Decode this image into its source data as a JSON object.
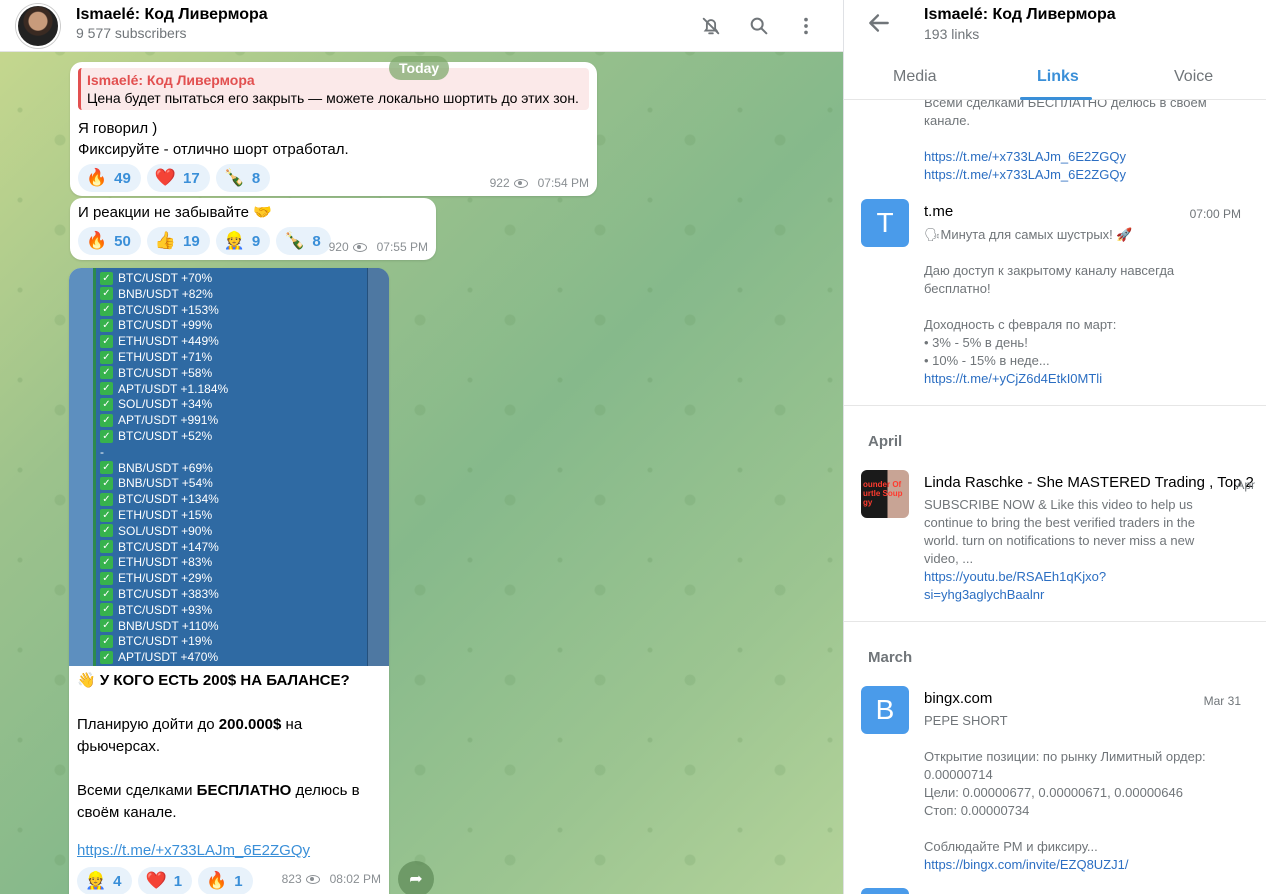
{
  "chat": {
    "title": "Ismaelé: Код Ливермора",
    "subtitle": "9 577 subscribers",
    "date_pill": "Today",
    "messages": [
      {
        "reply_name": "Ismaelé: Код Ливермора",
        "reply_text": "Цена будет пытаться его закрыть — можете локально шортить до этих зон.",
        "text": "Я говорил )\nФиксируйте - отлично шорт отработал.",
        "reactions": [
          {
            "emoji": "🔥",
            "count": "49"
          },
          {
            "emoji": "❤️",
            "count": "17"
          },
          {
            "emoji": "🍾",
            "count": "8"
          }
        ],
        "views": "922",
        "time": "07:54 PM"
      },
      {
        "text": "И реакции не забывайте 🤝",
        "reactions": [
          {
            "emoji": "🔥",
            "count": "50"
          },
          {
            "emoji": "👍",
            "count": "19"
          },
          {
            "emoji": "👷",
            "count": "9"
          },
          {
            "emoji": "🍾",
            "count": "8"
          }
        ],
        "views": "920",
        "time": "07:55 PM"
      },
      {
        "trades": [
          "BTC/USDT +70%",
          "BNB/USDT +82%",
          "BTC/USDT +153%",
          "BTC/USDT +99%",
          "ETH/USDT +449%",
          "ETH/USDT +71%",
          "BTC/USDT +58%",
          "APT/USDT +1.184%",
          "SOL/USDT +34%",
          "APT/USDT +991%",
          "BTC/USDT +52%",
          "-",
          "BNB/USDT +69%",
          "BNB/USDT +54%",
          "BTC/USDT +134%",
          "ETH/USDT +15%",
          "SOL/USDT +90%",
          "BTC/USDT +147%",
          "ETH/USDT +83%",
          "ETH/USDT +29%",
          "BTC/USDT +383%",
          "BTC/USDT +93%",
          "BNB/USDT +110%",
          "BTC/USDT +19%",
          "APT/USDT +470%"
        ],
        "line1": "👋 У КОГО ЕСТЬ 200$ НА БАЛАНСЕ?",
        "line2_a": "Планирую дойти до ",
        "line2_b": "200.000$",
        "line2_c": " на фьючерсах.",
        "line3_a": "Всеми сделками ",
        "line3_b": "БЕСПЛАТНО",
        "line3_c": " делюсь в своём канале.",
        "link": "https://t.me/+x733LAJm_6E2ZGQy",
        "reactions": [
          {
            "emoji": "👷",
            "count": "4"
          },
          {
            "emoji": "❤️",
            "count": "1"
          },
          {
            "emoji": "🔥",
            "count": "1"
          }
        ],
        "views": "823",
        "time": "08:02 PM"
      }
    ]
  },
  "panel": {
    "title": "Ismaelé: Код Ливермора",
    "subtitle": "193 links",
    "tabs": [
      "Media",
      "Links",
      "Voice"
    ],
    "active_tab": "Links",
    "top_fragment": {
      "text1": "Всеми сделками БЕСПЛАТНО делюсь в своем",
      "text2": "канале.",
      "link1": "https://t.me/+x733LAJm_6E2ZGQy",
      "link2": "https://t.me/+x733LAJm_6E2ZGQy"
    },
    "item_tme": {
      "icon_letter": "T",
      "title": "t.me",
      "time": "07:00 PM",
      "lines": [
        "🗣Минута для самых шустрых! 🚀",
        "",
        "Даю доступ к закрытому каналу навсегда",
        "бесплатно!",
        "",
        "Доходность с февраля по март:",
        "• 3% - 5% в день!",
        "• 10% - 15% в неде..."
      ],
      "link": "https://t.me/+yCjZ6d4EtkI0MTli"
    },
    "month_april": "April",
    "item_yt": {
      "thumb_text": "ounder Of\nurtle Soup\ngy",
      "title": "Linda Raschke - She MASTERED Trading , Top 2",
      "time": "Apr",
      "lines": [
        "SUBSCRIBE NOW & Like this video to help us",
        "continue to bring the best verified traders in the",
        "world. turn on notifications to never miss a new",
        "video, ..."
      ],
      "link1": "https://youtu.be/RSAEh1qKjxo?",
      "link2": "si=yhg3aglychBaalnr"
    },
    "month_march": "March",
    "item_bingx": {
      "icon_letter": "B",
      "title": "bingx.com",
      "time": "Mar 31",
      "lines": [
        "PEPE SHORT",
        "",
        "Открытие позиции: по рынку  Лимитный ордер:",
        "0.00000714",
        "Цели: 0.00000677, 0.00000671, 0.00000646",
        "Стоп: 0.00000734",
        "",
        "Соблюдайте РМ и фиксиру..."
      ],
      "link": "https://bingx.com/invite/EZQ8UZJ1/"
    }
  }
}
